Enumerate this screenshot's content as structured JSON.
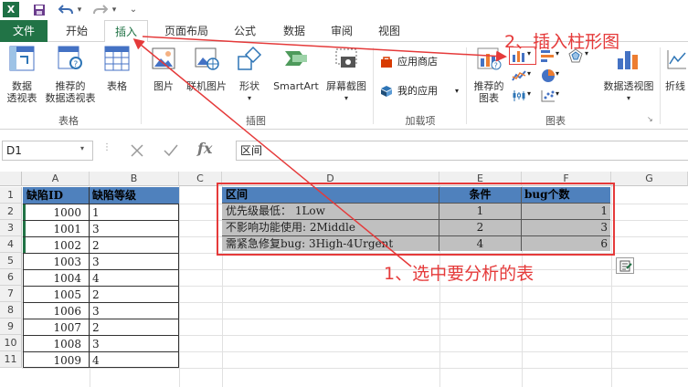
{
  "quick_access": {
    "app_icon": "X",
    "save_icon": "save-icon",
    "undo_icon": "undo-icon",
    "redo_icon": "redo-icon"
  },
  "tabs": [
    {
      "label": "文件"
    },
    {
      "label": "开始"
    },
    {
      "label": "插入"
    },
    {
      "label": "页面布局"
    },
    {
      "label": "公式"
    },
    {
      "label": "数据"
    },
    {
      "label": "审阅"
    },
    {
      "label": "视图"
    }
  ],
  "ribbon": {
    "tables_group": {
      "pivot_label_1": "数据",
      "pivot_label_2": "透视表",
      "recommended_pivot_1": "推荐的",
      "recommended_pivot_2": "数据透视表",
      "table_label": "表格",
      "group_label": "表格"
    },
    "illustrations_group": {
      "picture": "图片",
      "online_picture": "联机图片",
      "shapes": "形状",
      "smartart": "SmartArt",
      "screenshot": "屏幕截图",
      "group_label": "插图"
    },
    "addins_group": {
      "store": "应用商店",
      "my_apps": "我的应用",
      "group_label": "加载项"
    },
    "charts_group": {
      "recommended_1": "推荐的",
      "recommended_2": "图表",
      "pivot_chart": "数据透视图",
      "group_label": "图表"
    },
    "sparklines": {
      "line": "折线"
    }
  },
  "formula_bar": {
    "name_box": "D1",
    "fx": "fx",
    "value": "区间"
  },
  "columns": [
    "A",
    "B",
    "C",
    "D",
    "E",
    "F",
    "G"
  ],
  "rows": [
    "1",
    "2",
    "3",
    "4",
    "5",
    "6",
    "7",
    "8",
    "9",
    "10",
    "11"
  ],
  "left_table": {
    "headers": [
      "缺陷ID",
      "缺陷等级"
    ],
    "rows": [
      [
        "1000",
        "1"
      ],
      [
        "1001",
        "3"
      ],
      [
        "1002",
        "2"
      ],
      [
        "1003",
        "3"
      ],
      [
        "1004",
        "4"
      ],
      [
        "1005",
        "2"
      ],
      [
        "1006",
        "3"
      ],
      [
        "1007",
        "2"
      ],
      [
        "1008",
        "3"
      ],
      [
        "1009",
        "4"
      ]
    ]
  },
  "right_table": {
    "headers": [
      "区间",
      "条件",
      "bug个数"
    ],
    "rows": [
      [
        "优先级最低：      1Low",
        "1",
        "1"
      ],
      [
        "不影响功能使用: 2Middle",
        "2",
        "3"
      ],
      [
        "需紧急修复bug:  3High-4Urgent",
        "4",
        "6"
      ]
    ]
  },
  "annotations": {
    "step1": "1、选中要分析的表",
    "step2": "2、插入柱形图"
  },
  "colors": {
    "excel_green": "#217346",
    "annotation_red": "#e53a3a",
    "header_blue": "#4f81bd",
    "cell_gray": "#bfbfbf"
  }
}
